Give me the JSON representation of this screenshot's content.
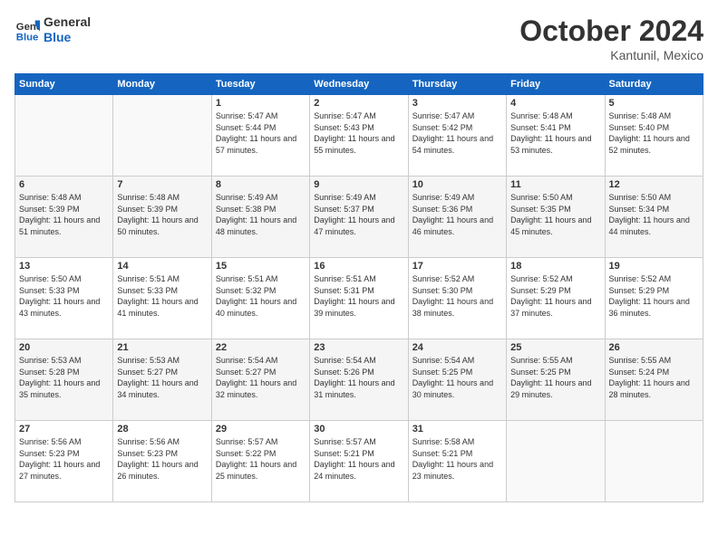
{
  "header": {
    "logo_line1": "General",
    "logo_line2": "Blue",
    "month": "October 2024",
    "location": "Kantunil, Mexico"
  },
  "weekdays": [
    "Sunday",
    "Monday",
    "Tuesday",
    "Wednesday",
    "Thursday",
    "Friday",
    "Saturday"
  ],
  "weeks": [
    [
      {
        "day": "",
        "sunrise": "",
        "sunset": "",
        "daylight": ""
      },
      {
        "day": "",
        "sunrise": "",
        "sunset": "",
        "daylight": ""
      },
      {
        "day": "1",
        "sunrise": "Sunrise: 5:47 AM",
        "sunset": "Sunset: 5:44 PM",
        "daylight": "Daylight: 11 hours and 57 minutes."
      },
      {
        "day": "2",
        "sunrise": "Sunrise: 5:47 AM",
        "sunset": "Sunset: 5:43 PM",
        "daylight": "Daylight: 11 hours and 55 minutes."
      },
      {
        "day": "3",
        "sunrise": "Sunrise: 5:47 AM",
        "sunset": "Sunset: 5:42 PM",
        "daylight": "Daylight: 11 hours and 54 minutes."
      },
      {
        "day": "4",
        "sunrise": "Sunrise: 5:48 AM",
        "sunset": "Sunset: 5:41 PM",
        "daylight": "Daylight: 11 hours and 53 minutes."
      },
      {
        "day": "5",
        "sunrise": "Sunrise: 5:48 AM",
        "sunset": "Sunset: 5:40 PM",
        "daylight": "Daylight: 11 hours and 52 minutes."
      }
    ],
    [
      {
        "day": "6",
        "sunrise": "Sunrise: 5:48 AM",
        "sunset": "Sunset: 5:39 PM",
        "daylight": "Daylight: 11 hours and 51 minutes."
      },
      {
        "day": "7",
        "sunrise": "Sunrise: 5:48 AM",
        "sunset": "Sunset: 5:39 PM",
        "daylight": "Daylight: 11 hours and 50 minutes."
      },
      {
        "day": "8",
        "sunrise": "Sunrise: 5:49 AM",
        "sunset": "Sunset: 5:38 PM",
        "daylight": "Daylight: 11 hours and 48 minutes."
      },
      {
        "day": "9",
        "sunrise": "Sunrise: 5:49 AM",
        "sunset": "Sunset: 5:37 PM",
        "daylight": "Daylight: 11 hours and 47 minutes."
      },
      {
        "day": "10",
        "sunrise": "Sunrise: 5:49 AM",
        "sunset": "Sunset: 5:36 PM",
        "daylight": "Daylight: 11 hours and 46 minutes."
      },
      {
        "day": "11",
        "sunrise": "Sunrise: 5:50 AM",
        "sunset": "Sunset: 5:35 PM",
        "daylight": "Daylight: 11 hours and 45 minutes."
      },
      {
        "day": "12",
        "sunrise": "Sunrise: 5:50 AM",
        "sunset": "Sunset: 5:34 PM",
        "daylight": "Daylight: 11 hours and 44 minutes."
      }
    ],
    [
      {
        "day": "13",
        "sunrise": "Sunrise: 5:50 AM",
        "sunset": "Sunset: 5:33 PM",
        "daylight": "Daylight: 11 hours and 43 minutes."
      },
      {
        "day": "14",
        "sunrise": "Sunrise: 5:51 AM",
        "sunset": "Sunset: 5:33 PM",
        "daylight": "Daylight: 11 hours and 41 minutes."
      },
      {
        "day": "15",
        "sunrise": "Sunrise: 5:51 AM",
        "sunset": "Sunset: 5:32 PM",
        "daylight": "Daylight: 11 hours and 40 minutes."
      },
      {
        "day": "16",
        "sunrise": "Sunrise: 5:51 AM",
        "sunset": "Sunset: 5:31 PM",
        "daylight": "Daylight: 11 hours and 39 minutes."
      },
      {
        "day": "17",
        "sunrise": "Sunrise: 5:52 AM",
        "sunset": "Sunset: 5:30 PM",
        "daylight": "Daylight: 11 hours and 38 minutes."
      },
      {
        "day": "18",
        "sunrise": "Sunrise: 5:52 AM",
        "sunset": "Sunset: 5:29 PM",
        "daylight": "Daylight: 11 hours and 37 minutes."
      },
      {
        "day": "19",
        "sunrise": "Sunrise: 5:52 AM",
        "sunset": "Sunset: 5:29 PM",
        "daylight": "Daylight: 11 hours and 36 minutes."
      }
    ],
    [
      {
        "day": "20",
        "sunrise": "Sunrise: 5:53 AM",
        "sunset": "Sunset: 5:28 PM",
        "daylight": "Daylight: 11 hours and 35 minutes."
      },
      {
        "day": "21",
        "sunrise": "Sunrise: 5:53 AM",
        "sunset": "Sunset: 5:27 PM",
        "daylight": "Daylight: 11 hours and 34 minutes."
      },
      {
        "day": "22",
        "sunrise": "Sunrise: 5:54 AM",
        "sunset": "Sunset: 5:27 PM",
        "daylight": "Daylight: 11 hours and 32 minutes."
      },
      {
        "day": "23",
        "sunrise": "Sunrise: 5:54 AM",
        "sunset": "Sunset: 5:26 PM",
        "daylight": "Daylight: 11 hours and 31 minutes."
      },
      {
        "day": "24",
        "sunrise": "Sunrise: 5:54 AM",
        "sunset": "Sunset: 5:25 PM",
        "daylight": "Daylight: 11 hours and 30 minutes."
      },
      {
        "day": "25",
        "sunrise": "Sunrise: 5:55 AM",
        "sunset": "Sunset: 5:25 PM",
        "daylight": "Daylight: 11 hours and 29 minutes."
      },
      {
        "day": "26",
        "sunrise": "Sunrise: 5:55 AM",
        "sunset": "Sunset: 5:24 PM",
        "daylight": "Daylight: 11 hours and 28 minutes."
      }
    ],
    [
      {
        "day": "27",
        "sunrise": "Sunrise: 5:56 AM",
        "sunset": "Sunset: 5:23 PM",
        "daylight": "Daylight: 11 hours and 27 minutes."
      },
      {
        "day": "28",
        "sunrise": "Sunrise: 5:56 AM",
        "sunset": "Sunset: 5:23 PM",
        "daylight": "Daylight: 11 hours and 26 minutes."
      },
      {
        "day": "29",
        "sunrise": "Sunrise: 5:57 AM",
        "sunset": "Sunset: 5:22 PM",
        "daylight": "Daylight: 11 hours and 25 minutes."
      },
      {
        "day": "30",
        "sunrise": "Sunrise: 5:57 AM",
        "sunset": "Sunset: 5:21 PM",
        "daylight": "Daylight: 11 hours and 24 minutes."
      },
      {
        "day": "31",
        "sunrise": "Sunrise: 5:58 AM",
        "sunset": "Sunset: 5:21 PM",
        "daylight": "Daylight: 11 hours and 23 minutes."
      },
      {
        "day": "",
        "sunrise": "",
        "sunset": "",
        "daylight": ""
      },
      {
        "day": "",
        "sunrise": "",
        "sunset": "",
        "daylight": ""
      }
    ]
  ]
}
